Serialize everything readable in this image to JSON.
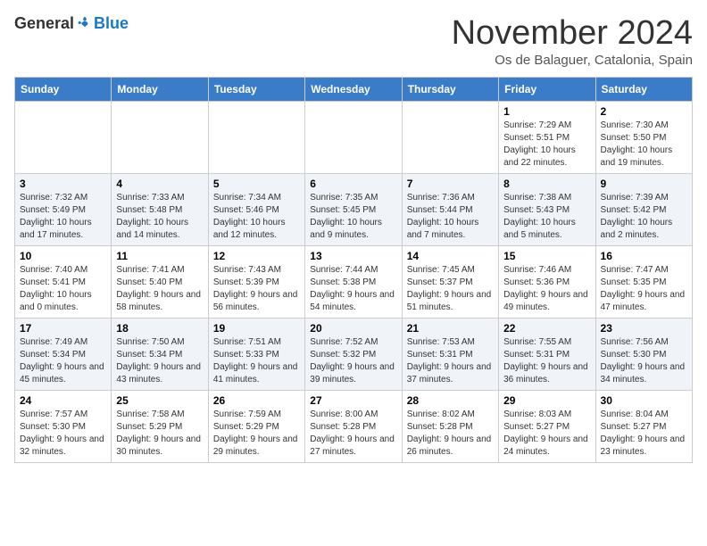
{
  "logo": {
    "general": "General",
    "blue": "Blue"
  },
  "title": "November 2024",
  "location": "Os de Balaguer, Catalonia, Spain",
  "weekdays": [
    "Sunday",
    "Monday",
    "Tuesday",
    "Wednesday",
    "Thursday",
    "Friday",
    "Saturday"
  ],
  "weeks": [
    [
      {
        "day": "",
        "info": ""
      },
      {
        "day": "",
        "info": ""
      },
      {
        "day": "",
        "info": ""
      },
      {
        "day": "",
        "info": ""
      },
      {
        "day": "",
        "info": ""
      },
      {
        "day": "1",
        "info": "Sunrise: 7:29 AM\nSunset: 5:51 PM\nDaylight: 10 hours and 22 minutes."
      },
      {
        "day": "2",
        "info": "Sunrise: 7:30 AM\nSunset: 5:50 PM\nDaylight: 10 hours and 19 minutes."
      }
    ],
    [
      {
        "day": "3",
        "info": "Sunrise: 7:32 AM\nSunset: 5:49 PM\nDaylight: 10 hours and 17 minutes."
      },
      {
        "day": "4",
        "info": "Sunrise: 7:33 AM\nSunset: 5:48 PM\nDaylight: 10 hours and 14 minutes."
      },
      {
        "day": "5",
        "info": "Sunrise: 7:34 AM\nSunset: 5:46 PM\nDaylight: 10 hours and 12 minutes."
      },
      {
        "day": "6",
        "info": "Sunrise: 7:35 AM\nSunset: 5:45 PM\nDaylight: 10 hours and 9 minutes."
      },
      {
        "day": "7",
        "info": "Sunrise: 7:36 AM\nSunset: 5:44 PM\nDaylight: 10 hours and 7 minutes."
      },
      {
        "day": "8",
        "info": "Sunrise: 7:38 AM\nSunset: 5:43 PM\nDaylight: 10 hours and 5 minutes."
      },
      {
        "day": "9",
        "info": "Sunrise: 7:39 AM\nSunset: 5:42 PM\nDaylight: 10 hours and 2 minutes."
      }
    ],
    [
      {
        "day": "10",
        "info": "Sunrise: 7:40 AM\nSunset: 5:41 PM\nDaylight: 10 hours and 0 minutes."
      },
      {
        "day": "11",
        "info": "Sunrise: 7:41 AM\nSunset: 5:40 PM\nDaylight: 9 hours and 58 minutes."
      },
      {
        "day": "12",
        "info": "Sunrise: 7:43 AM\nSunset: 5:39 PM\nDaylight: 9 hours and 56 minutes."
      },
      {
        "day": "13",
        "info": "Sunrise: 7:44 AM\nSunset: 5:38 PM\nDaylight: 9 hours and 54 minutes."
      },
      {
        "day": "14",
        "info": "Sunrise: 7:45 AM\nSunset: 5:37 PM\nDaylight: 9 hours and 51 minutes."
      },
      {
        "day": "15",
        "info": "Sunrise: 7:46 AM\nSunset: 5:36 PM\nDaylight: 9 hours and 49 minutes."
      },
      {
        "day": "16",
        "info": "Sunrise: 7:47 AM\nSunset: 5:35 PM\nDaylight: 9 hours and 47 minutes."
      }
    ],
    [
      {
        "day": "17",
        "info": "Sunrise: 7:49 AM\nSunset: 5:34 PM\nDaylight: 9 hours and 45 minutes."
      },
      {
        "day": "18",
        "info": "Sunrise: 7:50 AM\nSunset: 5:34 PM\nDaylight: 9 hours and 43 minutes."
      },
      {
        "day": "19",
        "info": "Sunrise: 7:51 AM\nSunset: 5:33 PM\nDaylight: 9 hours and 41 minutes."
      },
      {
        "day": "20",
        "info": "Sunrise: 7:52 AM\nSunset: 5:32 PM\nDaylight: 9 hours and 39 minutes."
      },
      {
        "day": "21",
        "info": "Sunrise: 7:53 AM\nSunset: 5:31 PM\nDaylight: 9 hours and 37 minutes."
      },
      {
        "day": "22",
        "info": "Sunrise: 7:55 AM\nSunset: 5:31 PM\nDaylight: 9 hours and 36 minutes."
      },
      {
        "day": "23",
        "info": "Sunrise: 7:56 AM\nSunset: 5:30 PM\nDaylight: 9 hours and 34 minutes."
      }
    ],
    [
      {
        "day": "24",
        "info": "Sunrise: 7:57 AM\nSunset: 5:30 PM\nDaylight: 9 hours and 32 minutes."
      },
      {
        "day": "25",
        "info": "Sunrise: 7:58 AM\nSunset: 5:29 PM\nDaylight: 9 hours and 30 minutes."
      },
      {
        "day": "26",
        "info": "Sunrise: 7:59 AM\nSunset: 5:29 PM\nDaylight: 9 hours and 29 minutes."
      },
      {
        "day": "27",
        "info": "Sunrise: 8:00 AM\nSunset: 5:28 PM\nDaylight: 9 hours and 27 minutes."
      },
      {
        "day": "28",
        "info": "Sunrise: 8:02 AM\nSunset: 5:28 PM\nDaylight: 9 hours and 26 minutes."
      },
      {
        "day": "29",
        "info": "Sunrise: 8:03 AM\nSunset: 5:27 PM\nDaylight: 9 hours and 24 minutes."
      },
      {
        "day": "30",
        "info": "Sunrise: 8:04 AM\nSunset: 5:27 PM\nDaylight: 9 hours and 23 minutes."
      }
    ]
  ]
}
